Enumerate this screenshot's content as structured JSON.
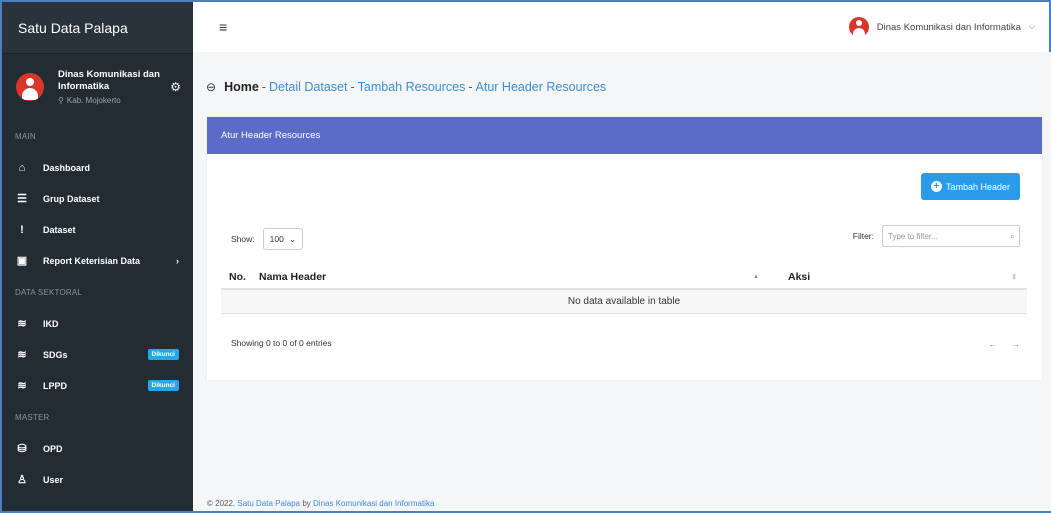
{
  "app": {
    "title": "Satu Data Palapa"
  },
  "profile": {
    "name": "Dinas Komunikasi dan Informatika",
    "location": "Kab. Mojokerto"
  },
  "sidebar": {
    "section_main": "MAIN",
    "section_sektoral": "DATA SEKTORAL",
    "section_master": "MASTER",
    "items": [
      {
        "label": "Dashboard",
        "icon": "home-icon"
      },
      {
        "label": "Grup Dataset",
        "icon": "list-icon"
      },
      {
        "label": "Dataset",
        "icon": "exclamation-icon"
      },
      {
        "label": "Report Keterisian Data",
        "icon": "report-icon"
      },
      {
        "label": "IKD",
        "icon": "layers-icon"
      },
      {
        "label": "SDGs",
        "icon": "layers-icon",
        "badge": "Dikunci"
      },
      {
        "label": "LPPD",
        "icon": "layers-icon",
        "badge": "Dikunci"
      },
      {
        "label": "OPD",
        "icon": "database-icon"
      },
      {
        "label": "User",
        "icon": "user-icon"
      }
    ]
  },
  "topbar": {
    "user_name": "Dinas Komunikasi dan Informatika"
  },
  "breadcrumb": {
    "home": "Home",
    "sep": "-",
    "items": [
      "Detail Dataset",
      "Tambah Resources",
      "Atur Header Resources"
    ]
  },
  "card": {
    "title": "Atur Header Resources",
    "add_button": "Tambah Header",
    "show_label": "Show:",
    "show_value": "100",
    "filter_label": "Filter:",
    "filter_placeholder": "Type to filter...",
    "columns": [
      "No.",
      "Nama Header",
      "Aksi"
    ],
    "empty_text": "No data available in table",
    "info": "Showing 0 to 0 of 0 entries",
    "prev": "←",
    "next": "→"
  },
  "footer": {
    "prefix": "© 2022.",
    "app_link": "Satu Data Palapa",
    "by": "by",
    "org_link": "Dinas Komunikasi dan Informatika"
  },
  "colors": {
    "sidebar_bg": "#232b33",
    "card_header": "#5b6bc8",
    "accent": "#2a9be8",
    "badge": "#28a7e4",
    "avatar": "#d9362b"
  }
}
